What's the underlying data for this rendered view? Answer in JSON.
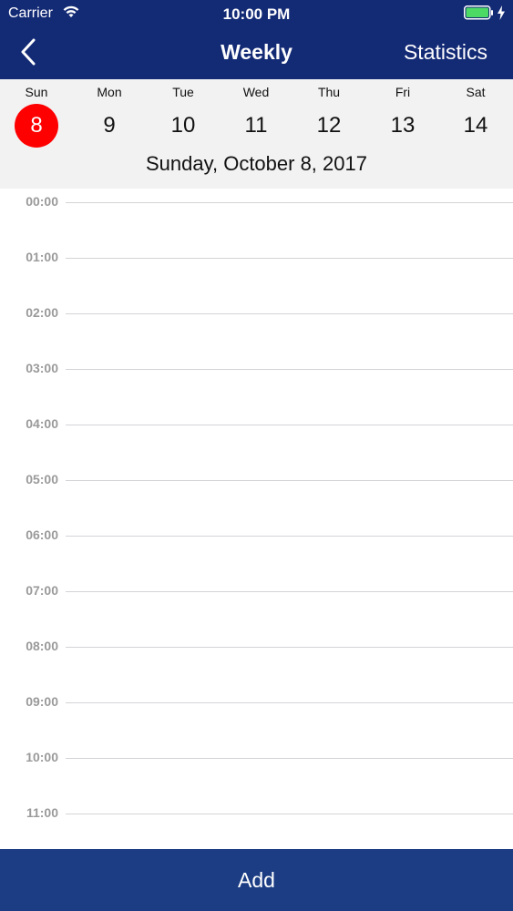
{
  "status_bar": {
    "carrier": "Carrier",
    "time": "10:00 PM",
    "wifi_icon": "wifi-icon",
    "battery_icon": "battery-icon",
    "charging_icon": "bolt-icon"
  },
  "nav": {
    "back_icon": "chevron-left-icon",
    "title": "Weekly",
    "right_button": "Statistics"
  },
  "week": {
    "days": [
      {
        "name": "Sun",
        "number": "8",
        "selected": true
      },
      {
        "name": "Mon",
        "number": "9",
        "selected": false
      },
      {
        "name": "Tue",
        "number": "10",
        "selected": false
      },
      {
        "name": "Wed",
        "number": "11",
        "selected": false
      },
      {
        "name": "Thu",
        "number": "12",
        "selected": false
      },
      {
        "name": "Fri",
        "number": "13",
        "selected": false
      },
      {
        "name": "Sat",
        "number": "14",
        "selected": false
      }
    ],
    "selected_date": "Sunday, October 8, 2017"
  },
  "timeline": {
    "hours": [
      "00:00",
      "01:00",
      "02:00",
      "03:00",
      "04:00",
      "05:00",
      "06:00",
      "07:00",
      "08:00",
      "09:00",
      "10:00",
      "11:00"
    ]
  },
  "footer": {
    "add_label": "Add"
  },
  "colors": {
    "nav_background": "#132a75",
    "footer_background": "#1c3d83",
    "selected_day": "#ff0000",
    "battery_fill": "#4cd964"
  }
}
